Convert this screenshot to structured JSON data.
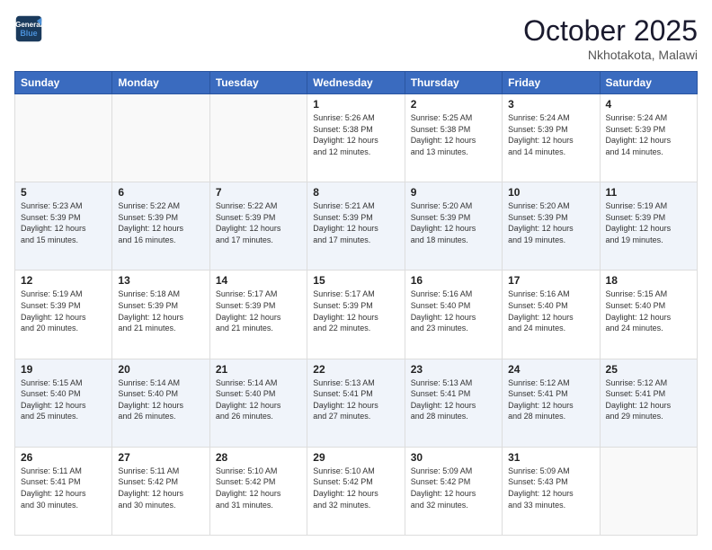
{
  "header": {
    "logo_line1": "General",
    "logo_line2": "Blue",
    "month": "October 2025",
    "location": "Nkhotakota, Malawi"
  },
  "days_of_week": [
    "Sunday",
    "Monday",
    "Tuesday",
    "Wednesday",
    "Thursday",
    "Friday",
    "Saturday"
  ],
  "weeks": [
    [
      {
        "day": "",
        "info": ""
      },
      {
        "day": "",
        "info": ""
      },
      {
        "day": "",
        "info": ""
      },
      {
        "day": "1",
        "info": "Sunrise: 5:26 AM\nSunset: 5:38 PM\nDaylight: 12 hours\nand 12 minutes."
      },
      {
        "day": "2",
        "info": "Sunrise: 5:25 AM\nSunset: 5:38 PM\nDaylight: 12 hours\nand 13 minutes."
      },
      {
        "day": "3",
        "info": "Sunrise: 5:24 AM\nSunset: 5:39 PM\nDaylight: 12 hours\nand 14 minutes."
      },
      {
        "day": "4",
        "info": "Sunrise: 5:24 AM\nSunset: 5:39 PM\nDaylight: 12 hours\nand 14 minutes."
      }
    ],
    [
      {
        "day": "5",
        "info": "Sunrise: 5:23 AM\nSunset: 5:39 PM\nDaylight: 12 hours\nand 15 minutes."
      },
      {
        "day": "6",
        "info": "Sunrise: 5:22 AM\nSunset: 5:39 PM\nDaylight: 12 hours\nand 16 minutes."
      },
      {
        "day": "7",
        "info": "Sunrise: 5:22 AM\nSunset: 5:39 PM\nDaylight: 12 hours\nand 17 minutes."
      },
      {
        "day": "8",
        "info": "Sunrise: 5:21 AM\nSunset: 5:39 PM\nDaylight: 12 hours\nand 17 minutes."
      },
      {
        "day": "9",
        "info": "Sunrise: 5:20 AM\nSunset: 5:39 PM\nDaylight: 12 hours\nand 18 minutes."
      },
      {
        "day": "10",
        "info": "Sunrise: 5:20 AM\nSunset: 5:39 PM\nDaylight: 12 hours\nand 19 minutes."
      },
      {
        "day": "11",
        "info": "Sunrise: 5:19 AM\nSunset: 5:39 PM\nDaylight: 12 hours\nand 19 minutes."
      }
    ],
    [
      {
        "day": "12",
        "info": "Sunrise: 5:19 AM\nSunset: 5:39 PM\nDaylight: 12 hours\nand 20 minutes."
      },
      {
        "day": "13",
        "info": "Sunrise: 5:18 AM\nSunset: 5:39 PM\nDaylight: 12 hours\nand 21 minutes."
      },
      {
        "day": "14",
        "info": "Sunrise: 5:17 AM\nSunset: 5:39 PM\nDaylight: 12 hours\nand 21 minutes."
      },
      {
        "day": "15",
        "info": "Sunrise: 5:17 AM\nSunset: 5:39 PM\nDaylight: 12 hours\nand 22 minutes."
      },
      {
        "day": "16",
        "info": "Sunrise: 5:16 AM\nSunset: 5:40 PM\nDaylight: 12 hours\nand 23 minutes."
      },
      {
        "day": "17",
        "info": "Sunrise: 5:16 AM\nSunset: 5:40 PM\nDaylight: 12 hours\nand 24 minutes."
      },
      {
        "day": "18",
        "info": "Sunrise: 5:15 AM\nSunset: 5:40 PM\nDaylight: 12 hours\nand 24 minutes."
      }
    ],
    [
      {
        "day": "19",
        "info": "Sunrise: 5:15 AM\nSunset: 5:40 PM\nDaylight: 12 hours\nand 25 minutes."
      },
      {
        "day": "20",
        "info": "Sunrise: 5:14 AM\nSunset: 5:40 PM\nDaylight: 12 hours\nand 26 minutes."
      },
      {
        "day": "21",
        "info": "Sunrise: 5:14 AM\nSunset: 5:40 PM\nDaylight: 12 hours\nand 26 minutes."
      },
      {
        "day": "22",
        "info": "Sunrise: 5:13 AM\nSunset: 5:41 PM\nDaylight: 12 hours\nand 27 minutes."
      },
      {
        "day": "23",
        "info": "Sunrise: 5:13 AM\nSunset: 5:41 PM\nDaylight: 12 hours\nand 28 minutes."
      },
      {
        "day": "24",
        "info": "Sunrise: 5:12 AM\nSunset: 5:41 PM\nDaylight: 12 hours\nand 28 minutes."
      },
      {
        "day": "25",
        "info": "Sunrise: 5:12 AM\nSunset: 5:41 PM\nDaylight: 12 hours\nand 29 minutes."
      }
    ],
    [
      {
        "day": "26",
        "info": "Sunrise: 5:11 AM\nSunset: 5:41 PM\nDaylight: 12 hours\nand 30 minutes."
      },
      {
        "day": "27",
        "info": "Sunrise: 5:11 AM\nSunset: 5:42 PM\nDaylight: 12 hours\nand 30 minutes."
      },
      {
        "day": "28",
        "info": "Sunrise: 5:10 AM\nSunset: 5:42 PM\nDaylight: 12 hours\nand 31 minutes."
      },
      {
        "day": "29",
        "info": "Sunrise: 5:10 AM\nSunset: 5:42 PM\nDaylight: 12 hours\nand 32 minutes."
      },
      {
        "day": "30",
        "info": "Sunrise: 5:09 AM\nSunset: 5:42 PM\nDaylight: 12 hours\nand 32 minutes."
      },
      {
        "day": "31",
        "info": "Sunrise: 5:09 AM\nSunset: 5:43 PM\nDaylight: 12 hours\nand 33 minutes."
      },
      {
        "day": "",
        "info": ""
      }
    ]
  ]
}
